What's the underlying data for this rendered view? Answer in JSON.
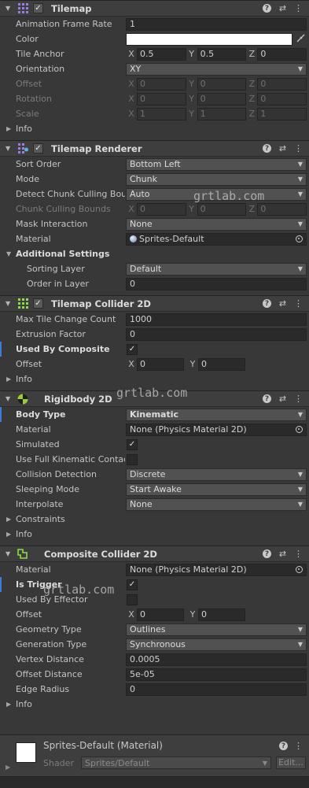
{
  "tilemap": {
    "title": "Tilemap",
    "animation_frame_rate_label": "Animation Frame Rate",
    "animation_frame_rate": "1",
    "color_label": "Color",
    "color_value": "#ffffff",
    "tile_anchor_label": "Tile Anchor",
    "tile_anchor": {
      "x": "0.5",
      "y": "0.5",
      "z": "0"
    },
    "orientation_label": "Orientation",
    "orientation": "XY",
    "offset_label": "Offset",
    "offset": {
      "x": "0",
      "y": "0",
      "z": "0"
    },
    "rotation_label": "Rotation",
    "rotation": {
      "x": "0",
      "y": "0",
      "z": "0"
    },
    "scale_label": "Scale",
    "scale": {
      "x": "1",
      "y": "1",
      "z": "1"
    },
    "info_label": "Info"
  },
  "tilemap_renderer": {
    "title": "Tilemap Renderer",
    "sort_order_label": "Sort Order",
    "sort_order": "Bottom Left",
    "mode_label": "Mode",
    "mode": "Chunk",
    "detect_culling_label": "Detect Chunk Culling Bou",
    "detect_culling": "Auto",
    "culling_bounds_label": "Chunk Culling Bounds",
    "culling_bounds": {
      "x": "0",
      "y": "0",
      "z": "0"
    },
    "mask_interaction_label": "Mask Interaction",
    "mask_interaction": "None",
    "material_label": "Material",
    "material": "Sprites-Default",
    "additional_settings_label": "Additional Settings",
    "sorting_layer_label": "Sorting Layer",
    "sorting_layer": "Default",
    "order_in_layer_label": "Order in Layer",
    "order_in_layer": "0"
  },
  "tilemap_collider": {
    "title": "Tilemap Collider 2D",
    "max_tile_change_label": "Max Tile Change Count",
    "max_tile_change": "1000",
    "extrusion_factor_label": "Extrusion Factor",
    "extrusion_factor": "0",
    "used_by_composite_label": "Used By Composite",
    "offset_label": "Offset",
    "offset": {
      "x": "0",
      "y": "0"
    },
    "info_label": "Info"
  },
  "rigidbody": {
    "title": "Rigidbody 2D",
    "body_type_label": "Body Type",
    "body_type": "Kinematic",
    "material_label": "Material",
    "material": "None (Physics Material 2D)",
    "simulated_label": "Simulated",
    "full_kinematic_label": "Use Full Kinematic Contac",
    "collision_detection_label": "Collision Detection",
    "collision_detection": "Discrete",
    "sleeping_mode_label": "Sleeping Mode",
    "sleeping_mode": "Start Awake",
    "interpolate_label": "Interpolate",
    "interpolate": "None",
    "constraints_label": "Constraints",
    "info_label": "Info"
  },
  "composite": {
    "title": "Composite Collider 2D",
    "material_label": "Material",
    "material": "None (Physics Material 2D)",
    "is_trigger_label": "Is Trigger",
    "used_by_effector_label": "Used By Effector",
    "offset_label": "Offset",
    "offset": {
      "x": "0",
      "y": "0"
    },
    "geometry_type_label": "Geometry Type",
    "geometry_type": "Outlines",
    "generation_type_label": "Generation Type",
    "generation_type": "Synchronous",
    "vertex_distance_label": "Vertex Distance",
    "vertex_distance": "0.0005",
    "offset_distance_label": "Offset Distance",
    "offset_distance": "5e-05",
    "edge_radius_label": "Edge Radius",
    "edge_radius": "0",
    "info_label": "Info"
  },
  "material_section": {
    "name": "Sprites-Default (Material)",
    "shader_label": "Shader",
    "shader": "Sprites/Default",
    "edit_label": "Edit..."
  },
  "axes": {
    "x": "X",
    "y": "Y",
    "z": "Z"
  },
  "watermark": "grtlab.com",
  "colors": {
    "accent_blue": "#3d7bd6",
    "panel_bg": "#383838",
    "header_bg": "#3e3e3e",
    "field_bg": "#2a2a2a",
    "dropdown_bg": "#515151",
    "rigidbody_icon": "#9acd32",
    "tilemap_icon": "#9b7fe6",
    "collider_icon": "#8ddc4a"
  }
}
